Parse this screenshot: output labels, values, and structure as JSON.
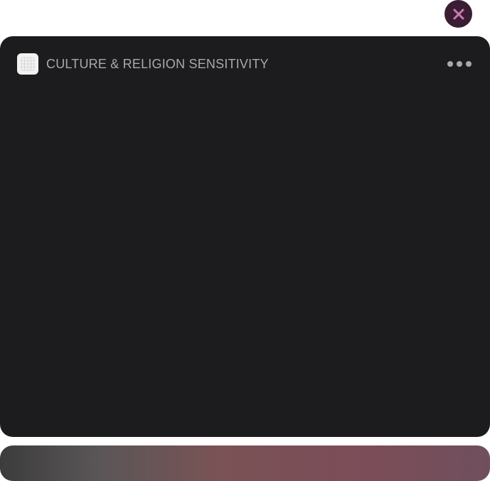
{
  "overlay": {
    "close_icon": "close-icon",
    "accent_color": "#c77bb0"
  },
  "widget": {
    "icon": "app-grid-icon",
    "title": "CULTURE & RELIGION SENSITIVITY",
    "menu_icon": "more-horizontal-icon",
    "background_color": "#1c1c1e"
  },
  "bottom_bar": {
    "colors": [
      "#3c3c3c",
      "#7a5355",
      "#704f5d"
    ]
  }
}
